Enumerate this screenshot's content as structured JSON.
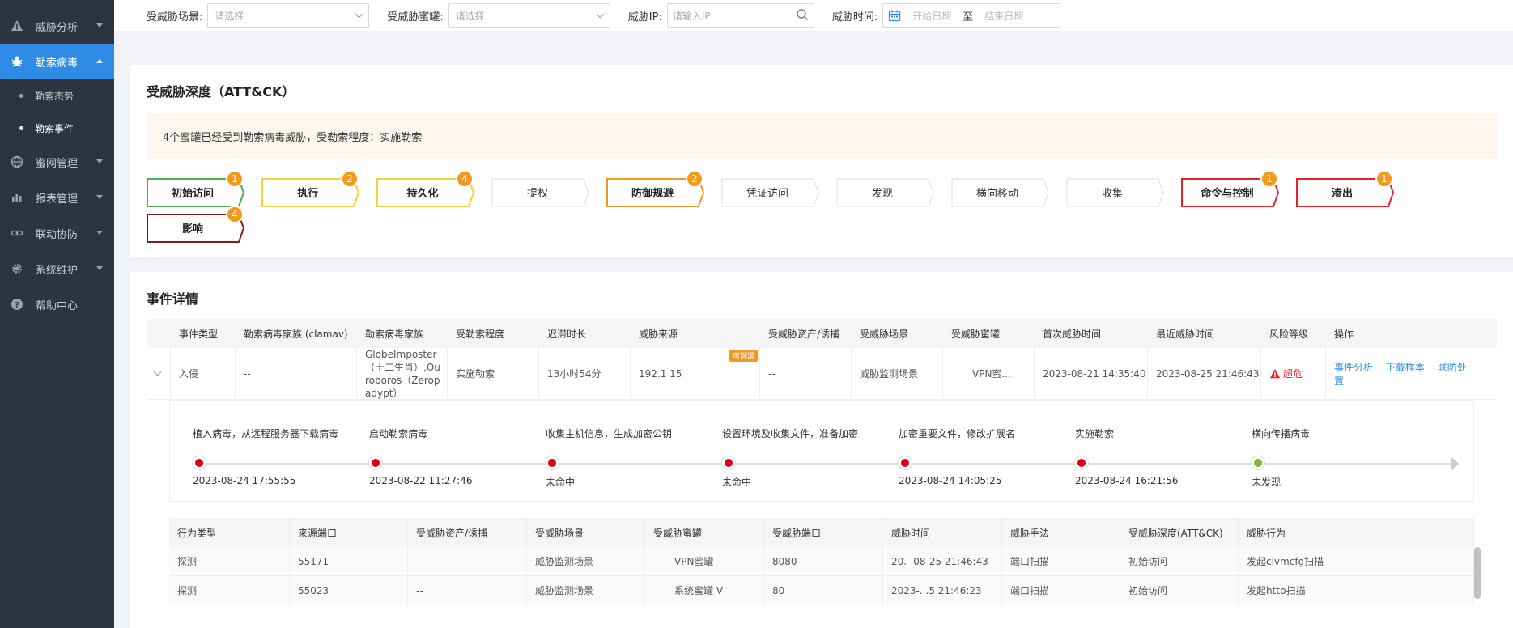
{
  "sidebar": {
    "items": [
      {
        "label": "威胁分析",
        "icon": "warning-icon"
      },
      {
        "label": "勒索病毒",
        "icon": "bug-icon",
        "active": true
      },
      {
        "label": "蜜网管理",
        "icon": "globe-icon"
      },
      {
        "label": "报表管理",
        "icon": "bar-chart-icon"
      },
      {
        "label": "联动协防",
        "icon": "link-icon"
      },
      {
        "label": "系统维护",
        "icon": "gear-icon"
      },
      {
        "label": "帮助中心",
        "icon": "help-icon"
      }
    ],
    "sub_items": [
      {
        "label": "勒索态势"
      },
      {
        "label": "勒索事件",
        "active": true
      }
    ]
  },
  "filters": {
    "scene_label": "受威胁场景:",
    "scene_placeholder": "请选择",
    "honeypot_label": "受威胁蜜罐:",
    "honeypot_placeholder": "请选择",
    "ip_label": "威胁IP:",
    "ip_placeholder": "请输入IP",
    "time_label": "威胁时间:",
    "start_placeholder": "开始日期",
    "sep": "至",
    "end_placeholder": "结束日期"
  },
  "depth": {
    "title": "受威胁深度（ATT&CK）",
    "notice": "4个蜜罐已经受到勒索病毒威胁，受勒索程度：实施勒索",
    "steps": [
      {
        "label": "初始访问",
        "badge": "1",
        "color": "#4caf50"
      },
      {
        "label": "执行",
        "badge": "2",
        "color": "#f5d23c"
      },
      {
        "label": "持久化",
        "badge": "4",
        "color": "#f5d23c"
      },
      {
        "label": "提权",
        "badge": "",
        "color": "#dddddd"
      },
      {
        "label": "防御规避",
        "badge": "2",
        "color": "#f29a1f"
      },
      {
        "label": "凭证访问",
        "badge": "",
        "color": "#dddddd"
      },
      {
        "label": "发现",
        "badge": "",
        "color": "#dddddd"
      },
      {
        "label": "横向移动",
        "badge": "",
        "color": "#dddddd"
      },
      {
        "label": "收集",
        "badge": "",
        "color": "#dddddd"
      },
      {
        "label": "命令与控制",
        "badge": "1",
        "color": "#e8222d"
      },
      {
        "label": "渗出",
        "badge": "1",
        "color": "#e8222d"
      },
      {
        "label": "影响",
        "badge": "4",
        "color": "#8b1a1a"
      }
    ]
  },
  "events": {
    "title": "事件详情",
    "headers": [
      "事件类型",
      "勒索病毒家族 (clamav)",
      "勒索病毒家族",
      "受勒索程度",
      "迟滞时长",
      "威胁来源",
      "受威胁资产/诱捕",
      "受威胁场景",
      "受威胁蜜罐",
      "首次威胁时间",
      "最近威胁时间",
      "风险等级",
      "操作"
    ],
    "row": {
      "type": "入侵",
      "clamav": "--",
      "family": "GlobeImposter（十二生肖）,Ouroboros（Zeropadypt）",
      "degree": "实施勒索",
      "delay": "13小时54分",
      "source": "192.1        15",
      "source_tag": "可溯源",
      "asset": "--",
      "scene": "威胁监测场景",
      "honeypot": "VPN蜜...",
      "first": "2023-08-21 14:35:40",
      "last": "2023-08-25 21:46:43",
      "risk": "超危",
      "ops": [
        "事件分析",
        "下载样本",
        "联防处置"
      ]
    },
    "timeline": [
      {
        "title": "植入病毒，从远程服务器下载病毒",
        "time": "2023-08-24 17:55:55",
        "color": "#d9001b"
      },
      {
        "title": "启动勒索病毒",
        "time": "2023-08-22 11:27:46",
        "color": "#d9001b"
      },
      {
        "title": "收集主机信息，生成加密公钥",
        "time": "未命中",
        "color": "#d9001b"
      },
      {
        "title": "设置环境及收集文件，准备加密",
        "time": "未命中",
        "color": "#d9001b"
      },
      {
        "title": "加密重要文件，修改扩展名",
        "time": "2023-08-24 14:05:25",
        "color": "#d9001b"
      },
      {
        "title": "实施勒索",
        "time": "2023-08-24 16:21:56",
        "color": "#d9001b"
      },
      {
        "title": "横向传播病毒",
        "time": "未发现",
        "color": "#7cb82f"
      }
    ],
    "sub_headers": [
      "行为类型",
      "来源端口",
      "受威胁资产/诱捕",
      "受威胁场景",
      "受威胁蜜罐",
      "受威胁端口",
      "威胁时间",
      "威胁手法",
      "受威胁深度(ATT&CK)",
      "威胁行为"
    ],
    "sub_rows": [
      [
        "探测",
        "55171",
        "--",
        "威胁监测场景",
        "VPN蜜罐",
        "8080",
        "20.  -08-25 21:46:43",
        "端口扫描",
        "初始访问",
        "发起clvmcfg扫描"
      ],
      [
        "探测",
        "55023",
        "--",
        "威胁监测场景",
        "系统蜜罐 V",
        "80",
        "2023-.   .5 21:46:23",
        "端口扫描",
        "初始访问",
        "发起http扫描"
      ]
    ]
  }
}
